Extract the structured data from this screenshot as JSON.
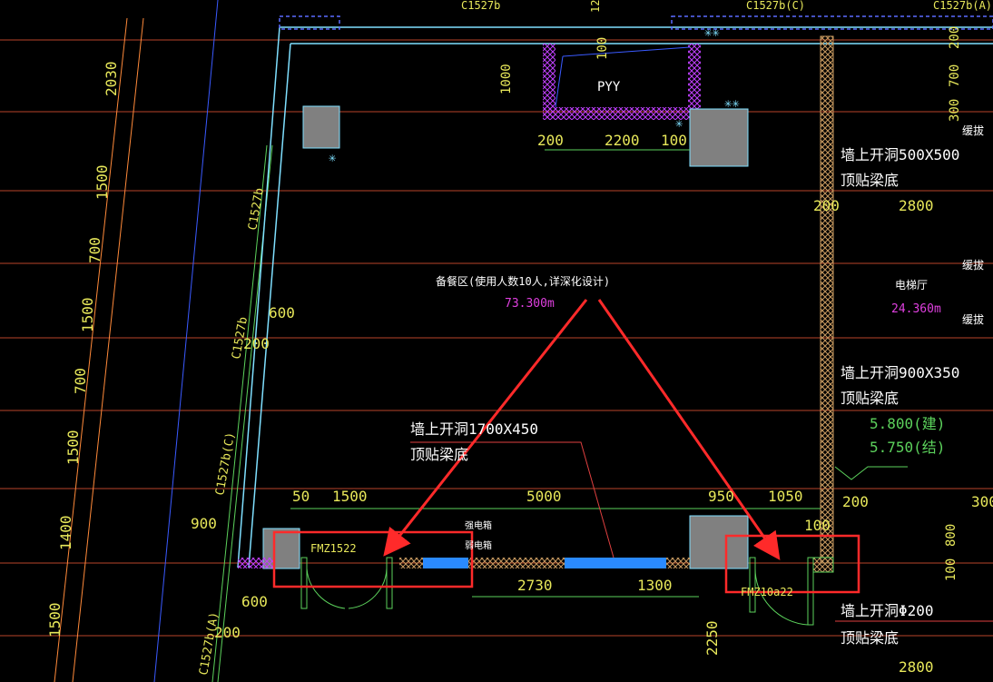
{
  "labels": {
    "top_c1527b_1": "C1527b",
    "top_12": "12",
    "top_c1527b_c": "C1527b(C)",
    "top_c1527b_a": "C1527b(A)",
    "pyy": "PYY",
    "dim_100_top": "100",
    "dim_1000": "1000",
    "dim_200_a": "200",
    "dim_2200": "2200",
    "dim_100_b": "100",
    "dim_200_right_top": "200",
    "dim_700_right": "700",
    "dim_300_right": "300",
    "left_2030": "2030",
    "left_1500_a": "1500",
    "left_700_a": "700",
    "left_1500_b": "1500",
    "left_700_b": "700",
    "left_1500_c": "1500",
    "left_1400": "1400",
    "left_1500_d": "1500",
    "win_c1527b_a": "C1527b",
    "win_c1527b_b": "C1527b",
    "win_200": "200",
    "dim_600_a": "600",
    "win_c1527b_c": "C1527b(C)",
    "dim_900": "900",
    "dim_600_b": "600",
    "win_c1527b_a2": "C1527b(A)",
    "dim_200_bl": "200",
    "note_open_1_l1": "墙上开洞500X500",
    "note_open_1_l2": "顶贴梁底",
    "dim_200_r": "200",
    "dim_2800_a": "2800",
    "room_main_name": "备餐区(使用人数10人,详深化设计)",
    "room_main_level": "73.300m",
    "room_elev_name": "电梯厅",
    "room_elev_level": "24.360m",
    "side_label_a": "缓拔",
    "side_label_b": "缓拔",
    "side_label_c": "缓拔",
    "note_open_2_l1": "墙上开洞900X350",
    "note_open_2_l2": "顶贴梁底",
    "level_build": "5.800(建)",
    "level_struct": "5.750(结)",
    "note_open_3_l1": "墙上开洞1700X450",
    "note_open_3_l2": "顶贴梁底",
    "dim_50": "50",
    "dim_1500_bottom": "1500",
    "dim_5000": "5000",
    "dim_950": "950",
    "dim_1050": "1050",
    "dim_200_br": "200",
    "dim_100_br": "100",
    "dim_300_far": "300",
    "dim_800_far": "800",
    "dim_100_far": "100",
    "door_left": "FMZ1522",
    "panel_1": "强电箱",
    "panel_2": "弱电箱",
    "dim_2730": "2730",
    "dim_1300": "1300",
    "door_right": "FMZ10a22",
    "dim_2250": "2250",
    "note_open_4_l1": "墙上开洞Φ200",
    "note_open_4_l2": "顶贴梁底",
    "dim_2800_b": "2800"
  },
  "colors": {
    "background": "#000000",
    "dim_text": "#e8e85a",
    "note_text": "#ffffff",
    "level_text": "#e040e0",
    "elevation_text": "#5cd25c",
    "wall": "#7fe0ff",
    "highlight": "#ff2a2a",
    "grid": "#ff6a3a",
    "hatch": "#c040ff",
    "column": "#808080"
  }
}
